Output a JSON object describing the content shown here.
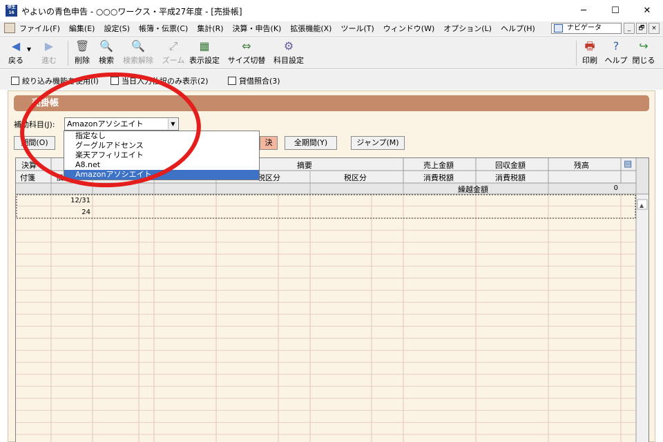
{
  "window": {
    "title": "やよいの青色申告 - ○○○ワークス・平成27年度 - [売掛帳]",
    "icon_text": "弥生 16",
    "minimize": "─",
    "maximize": "☐",
    "close": "✕"
  },
  "menu": {
    "items": [
      "ファイル(F)",
      "編集(E)",
      "設定(S)",
      "帳簿・伝票(C)",
      "集計(R)",
      "決算・申告(K)",
      "拡張機能(X)",
      "ツール(T)",
      "ウィンドウ(W)",
      "オプション(L)",
      "ヘルプ(H)"
    ],
    "navigator": "ナビゲータ",
    "mdi_min": "_",
    "mdi_restore": "🗗",
    "mdi_close": "×"
  },
  "toolbar": {
    "back": "戻る",
    "forward": "進む",
    "delete": "削除",
    "search": "検索",
    "clear_search": "検索解除",
    "zoom": "ズーム",
    "display_settings": "表示設定",
    "size_switch": "サイズ切替",
    "account_settings": "科目設定",
    "print": "印刷",
    "help": "ヘルプ",
    "close": "閉じる"
  },
  "options": {
    "filter": "絞り込み機能を使用(I)",
    "same_day_only": "当日入力仕訳のみ表示(2)",
    "reconcile": "貸借照合(3)"
  },
  "panel": {
    "title": "売掛帳",
    "sub_account_label": "補助科目(J):",
    "sub_account_value": "Amazonアソシエイト",
    "period_button": "期間(O)",
    "settle_button": "決",
    "all_period_button": "全期間(Y)",
    "jump_button": "ジャンプ(M)"
  },
  "dropdown": {
    "options": [
      "指定なし",
      "グーグルアドセンス",
      "楽天アフィリエイト",
      "A8.net",
      "Amazonアソシエイト"
    ],
    "selected_index": 4
  },
  "grid": {
    "headers_row1": {
      "settle": "決算",
      "summary": "摘要",
      "sales": "売上金額",
      "collected": "回収金額",
      "balance": "残高"
    },
    "headers_row2": {
      "tag": "付箋",
      "slip": "伝",
      "tax_cat_left": "税区分",
      "tax_cat": "税区分",
      "sales_tax": "消費税額",
      "collected_tax": "消費税額"
    },
    "carry_forward_label": "繰越金額",
    "carry_forward_value": "0",
    "entry_date": "12/31",
    "entry_day": "24"
  }
}
